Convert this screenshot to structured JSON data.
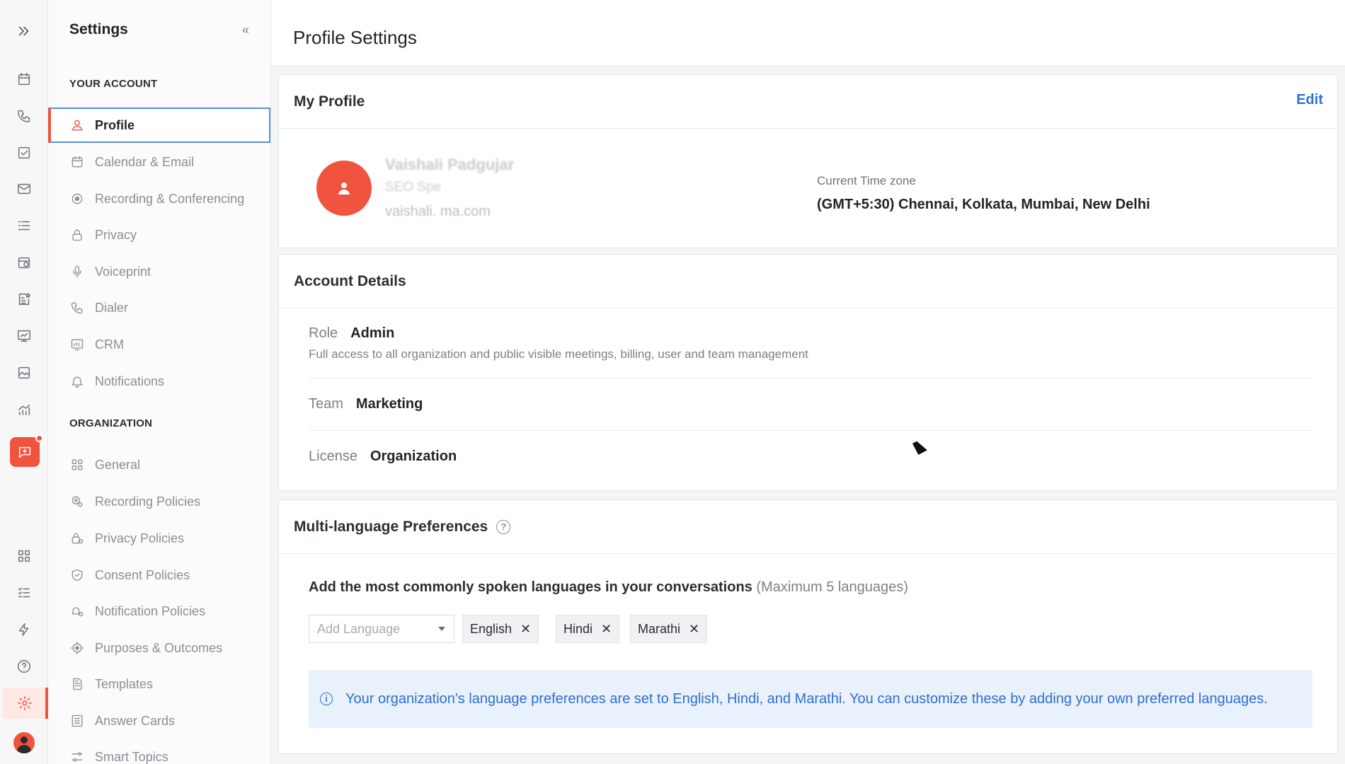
{
  "sidebar": {
    "title": "Settings",
    "your_account_label": "YOUR ACCOUNT",
    "account_items": [
      {
        "label": "Profile"
      },
      {
        "label": "Calendar & Email"
      },
      {
        "label": "Recording & Conferencing"
      },
      {
        "label": "Privacy"
      },
      {
        "label": "Voiceprint"
      },
      {
        "label": "Dialer"
      },
      {
        "label": "CRM"
      },
      {
        "label": "Notifications"
      }
    ],
    "organization_label": "ORGANIZATION",
    "org_items": [
      {
        "label": "General"
      },
      {
        "label": "Recording Policies"
      },
      {
        "label": "Privacy Policies"
      },
      {
        "label": "Consent Policies"
      },
      {
        "label": "Notification Policies"
      },
      {
        "label": "Purposes & Outcomes"
      },
      {
        "label": "Templates"
      },
      {
        "label": "Answer Cards"
      },
      {
        "label": "Smart Topics"
      }
    ]
  },
  "page": {
    "title": "Profile Settings"
  },
  "my_profile": {
    "heading": "My Profile",
    "edit_label": "Edit",
    "name": "Vaishali Padgujar",
    "role": "SEO Spe",
    "email": "vaishali.                    ma.com",
    "timezone_label": "Current Time zone",
    "timezone_value": "(GMT+5:30) Chennai, Kolkata, Mumbai, New Delhi"
  },
  "account_details": {
    "heading": "Account Details",
    "role_label": "Role",
    "role_value": "Admin",
    "role_desc": "Full access to all organization and public visible meetings, billing, user and team management",
    "team_label": "Team",
    "team_value": "Marketing",
    "license_label": "License",
    "license_value": "Organization"
  },
  "languages": {
    "heading": "Multi-language Preferences",
    "help_bold": "Add the most commonly spoken languages in your conversations",
    "help_muted": "(Maximum 5 languages)",
    "add_placeholder": "Add Language",
    "selected": [
      "English",
      "Hindi",
      "Marathi"
    ],
    "remove_glyph": "✕",
    "info_text": "Your organization's language preferences are set to English, Hindi, and Marathi. You can customize these by adding your own preferred languages."
  },
  "colors": {
    "accent": "#f0543f",
    "link": "#2f6fd0",
    "info_bg": "#e8f1fc"
  },
  "icons": {
    "rail": [
      "expand-icon",
      "calendar-icon",
      "phone-icon",
      "checkbox-icon",
      "mail-icon",
      "list-icon",
      "schedule-icon",
      "notes-star-icon",
      "presentation-icon",
      "image-icon",
      "analytics-icon",
      "chat-spark-icon",
      "apps-icon",
      "tasks-icon",
      "bolt-icon",
      "help-icon",
      "settings-icon",
      "user-avatar-icon"
    ]
  }
}
